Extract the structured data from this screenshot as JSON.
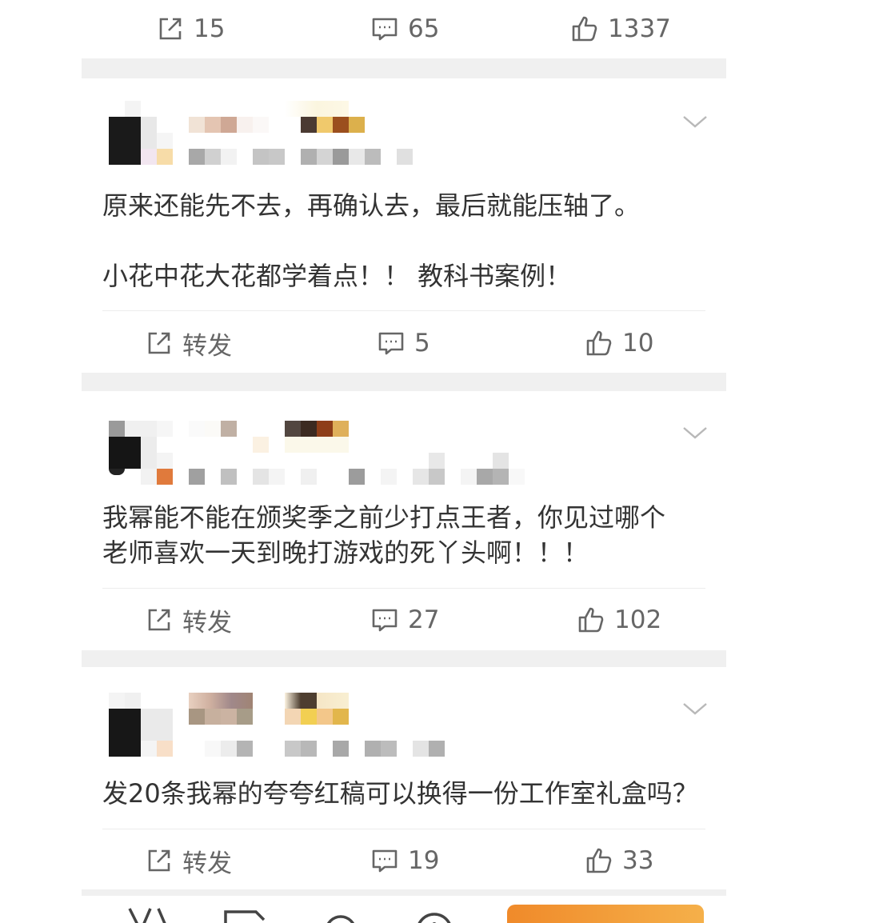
{
  "top_actions": {
    "repost": "15",
    "comment": "65",
    "like": "1337"
  },
  "posts": [
    {
      "text": "原来还能先不去，再确认去，最后就能压轴了。\n\n小花中花大花都学着点！！ 教科书案例！",
      "repost": "转发",
      "comment": "5",
      "like": "10"
    },
    {
      "text": "我幂能不能在颁奖季之前少打点王者，你见过哪个\n老师喜欢一天到晚打游戏的死丫头啊！！！",
      "repost": "转发",
      "comment": "27",
      "like": "102"
    },
    {
      "text": "发20条我幂的夸夸红稿可以换得一份工作室礼盒吗？",
      "repost": "转发",
      "comment": "19",
      "like": "33"
    }
  ],
  "colors": {
    "divider": "#f0f0f0",
    "text": "#333333",
    "action_text": "#666666",
    "accent": "#f08a2a"
  },
  "icons": [
    "repost-icon",
    "comment-icon",
    "like-icon",
    "chevron-down-icon"
  ]
}
